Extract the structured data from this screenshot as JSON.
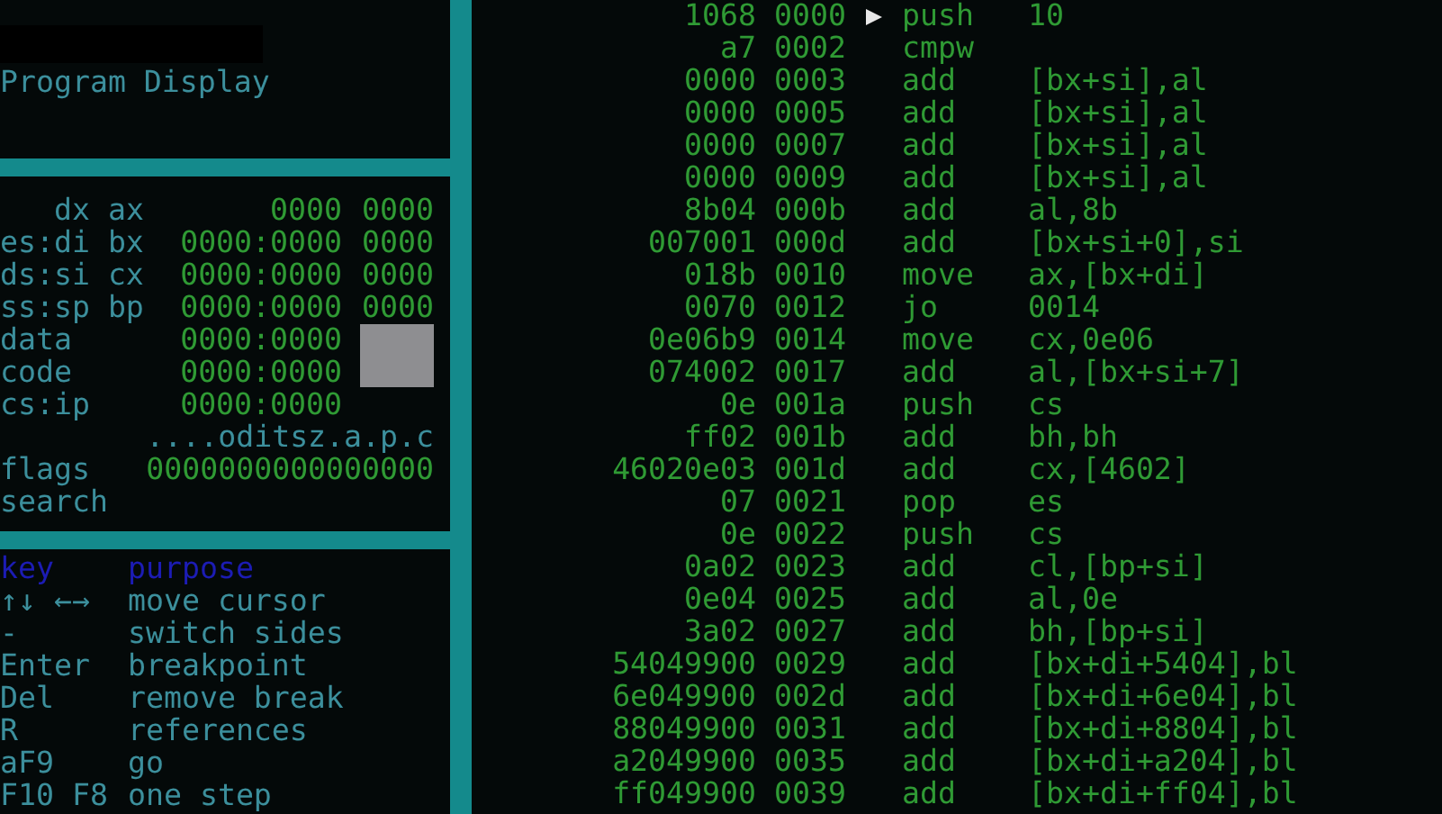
{
  "program_panel": {
    "title": "Program Display"
  },
  "registers": [
    {
      "label": "dx ax",
      "value": "0000",
      "extra": "0000"
    },
    {
      "label": "es:di bx",
      "value": "0000:0000",
      "extra": "0000"
    },
    {
      "label": "ds:si cx",
      "value": "0000:0000",
      "extra": "0000"
    },
    {
      "label": "ss:sp bp",
      "value": "0000:0000",
      "extra": "0000"
    },
    {
      "label": "data",
      "value": "0000:0000"
    },
    {
      "label": "code",
      "value": "0000:0000"
    },
    {
      "label": "cs:ip",
      "value": "0000:0000"
    }
  ],
  "flags": {
    "legend": "....oditsz.a.p.c",
    "label": "flags",
    "value": "0000000000000000"
  },
  "search": {
    "label": "search"
  },
  "help": {
    "header": {
      "key": "key",
      "purpose": "purpose"
    },
    "rows": [
      {
        "key": "↑↓ ←→",
        "purpose": "move cursor"
      },
      {
        "key": "-",
        "purpose": "switch sides"
      },
      {
        "key": "Enter",
        "purpose": "breakpoint"
      },
      {
        "key": "Del",
        "purpose": "remove break"
      },
      {
        "key": "R",
        "purpose": "references"
      },
      {
        "key": "aF9",
        "purpose": "go"
      },
      {
        "key": "F10 F8",
        "purpose": "one step"
      }
    ]
  },
  "disassembly": [
    {
      "bytes": "1068",
      "address": "0000",
      "current": true,
      "mnemonic": "push",
      "operand": "10"
    },
    {
      "bytes": "a7",
      "address": "0002",
      "current": false,
      "mnemonic": "cmpw"
    },
    {
      "bytes": "0000",
      "address": "0003",
      "current": false,
      "mnemonic": "add",
      "operand": "[bx+si],al"
    },
    {
      "bytes": "0000",
      "address": "0005",
      "current": false,
      "mnemonic": "add",
      "operand": "[bx+si],al"
    },
    {
      "bytes": "0000",
      "address": "0007",
      "current": false,
      "mnemonic": "add",
      "operand": "[bx+si],al"
    },
    {
      "bytes": "0000",
      "address": "0009",
      "current": false,
      "mnemonic": "add",
      "operand": "[bx+si],al"
    },
    {
      "bytes": "8b04",
      "address": "000b",
      "current": false,
      "mnemonic": "add",
      "operand": "al,8b"
    },
    {
      "bytes": "007001",
      "address": "000d",
      "current": false,
      "mnemonic": "add",
      "operand": "[bx+si+0],si"
    },
    {
      "bytes": "018b",
      "address": "0010",
      "current": false,
      "mnemonic": "move",
      "operand": "ax,[bx+di]"
    },
    {
      "bytes": "0070",
      "address": "0012",
      "current": false,
      "mnemonic": "jo",
      "operand": "0014"
    },
    {
      "bytes": "0e06b9",
      "address": "0014",
      "current": false,
      "mnemonic": "move",
      "operand": "cx,0e06"
    },
    {
      "bytes": "074002",
      "address": "0017",
      "current": false,
      "mnemonic": "add",
      "operand": "al,[bx+si+7]"
    },
    {
      "bytes": "0e",
      "address": "001a",
      "current": false,
      "mnemonic": "push",
      "operand": "cs"
    },
    {
      "bytes": "ff02",
      "address": "001b",
      "current": false,
      "mnemonic": "add",
      "operand": "bh,bh"
    },
    {
      "bytes": "46020e03",
      "address": "001d",
      "current": false,
      "mnemonic": "add",
      "operand": "cx,[4602]"
    },
    {
      "bytes": "07",
      "address": "0021",
      "current": false,
      "mnemonic": "pop",
      "operand": "es"
    },
    {
      "bytes": "0e",
      "address": "0022",
      "current": false,
      "mnemonic": "push",
      "operand": "cs"
    },
    {
      "bytes": "0a02",
      "address": "0023",
      "current": false,
      "mnemonic": "add",
      "operand": "cl,[bp+si]"
    },
    {
      "bytes": "0e04",
      "address": "0025",
      "current": false,
      "mnemonic": "add",
      "operand": "al,0e"
    },
    {
      "bytes": "3a02",
      "address": "0027",
      "current": false,
      "mnemonic": "add",
      "operand": "bh,[bp+si]"
    },
    {
      "bytes": "54049900",
      "address": "0029",
      "current": false,
      "mnemonic": "add",
      "operand": "[bx+di+5404],bl"
    },
    {
      "bytes": "6e049900",
      "address": "002d",
      "current": false,
      "mnemonic": "add",
      "operand": "[bx+di+6e04],bl"
    },
    {
      "bytes": "88049900",
      "address": "0031",
      "current": false,
      "mnemonic": "add",
      "operand": "[bx+di+8804],bl"
    },
    {
      "bytes": "a2049900",
      "address": "0035",
      "current": false,
      "mnemonic": "add",
      "operand": "[bx+di+a204],bl"
    },
    {
      "bytes": "ff049900",
      "address": "0039",
      "current": false,
      "mnemonic": "add",
      "operand": "[bx+di+ff04],bl"
    }
  ]
}
